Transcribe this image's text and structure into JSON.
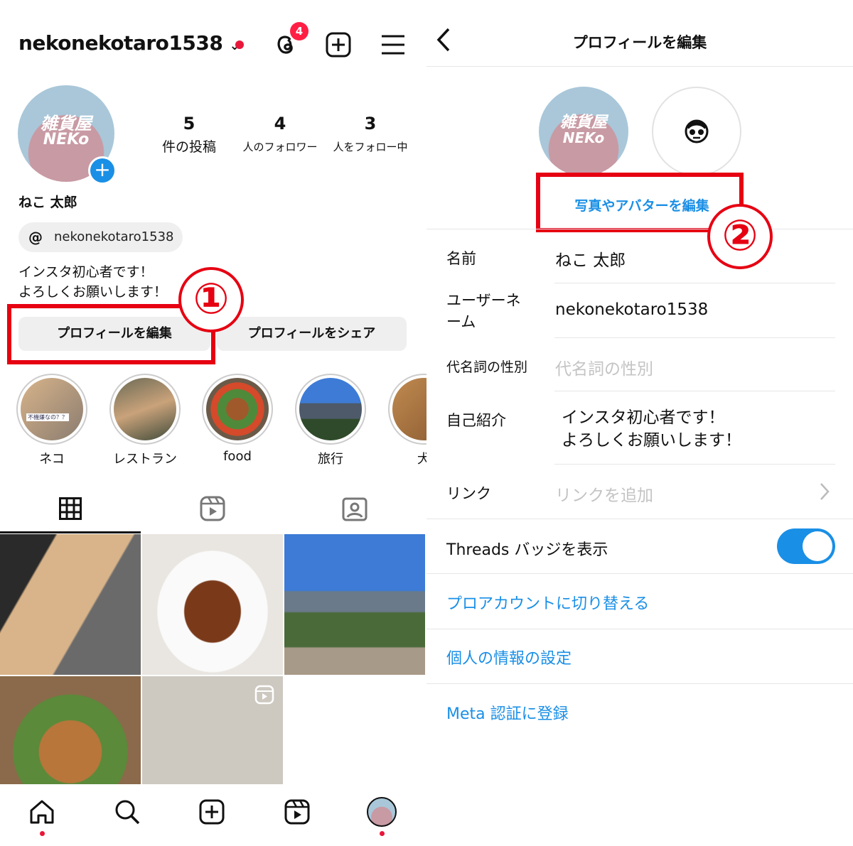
{
  "left": {
    "username": "nekonekotaro1538",
    "threads_badge_count": "4",
    "display_name": "ねこ 太郎",
    "avatar_text": [
      "雑貨屋",
      "NEKo"
    ],
    "stats": [
      {
        "value": "5",
        "label": "件の投稿"
      },
      {
        "value": "4",
        "label": "人のフォロワー"
      },
      {
        "value": "3",
        "label": "人をフォロー中"
      }
    ],
    "threads_handle": "nekonekotaro1538",
    "bio": [
      "インスタ初心者です！",
      "よろしくお願いします！"
    ],
    "edit_profile": "プロフィールを編集",
    "share_profile": "プロフィールをシェア",
    "step_marker": "①",
    "story_sticker": "不機嫌なの？？",
    "highlights": [
      {
        "label": "ネコ"
      },
      {
        "label": "レストラン"
      },
      {
        "label": "food"
      },
      {
        "label": "旅行"
      },
      {
        "label": "犬"
      }
    ],
    "tabs": [
      "grid",
      "reels",
      "tagged"
    ],
    "active_tab": "grid",
    "bottom_nav": [
      "home",
      "search",
      "create",
      "reels",
      "profile"
    ]
  },
  "right": {
    "title": "プロフィールを編集",
    "edit_photo": "写真やアバターを編集",
    "step_marker": "②",
    "fields": [
      {
        "label": "名前",
        "value": "ねこ 太郎"
      },
      {
        "label": "ユーザーネーム",
        "value": "nekonekotaro1538"
      },
      {
        "label": "代名詞の性別",
        "placeholder": "代名詞の性別"
      },
      {
        "label": "自己紹介",
        "value": [
          "インスタ初心者です！",
          "よろしくお願いします！"
        ]
      },
      {
        "label": "リンク",
        "placeholder": "リンクを追加"
      }
    ],
    "threads_badge_label": "Threads バッジを表示",
    "threads_badge_on": true,
    "links": [
      "プロアカウントに切り替える",
      "個人の情報の設定",
      "Meta 認証に登録"
    ]
  },
  "colors": {
    "accent": "#1a8fe6",
    "highlight_red": "#e60012",
    "notification": "#ff1f44"
  }
}
